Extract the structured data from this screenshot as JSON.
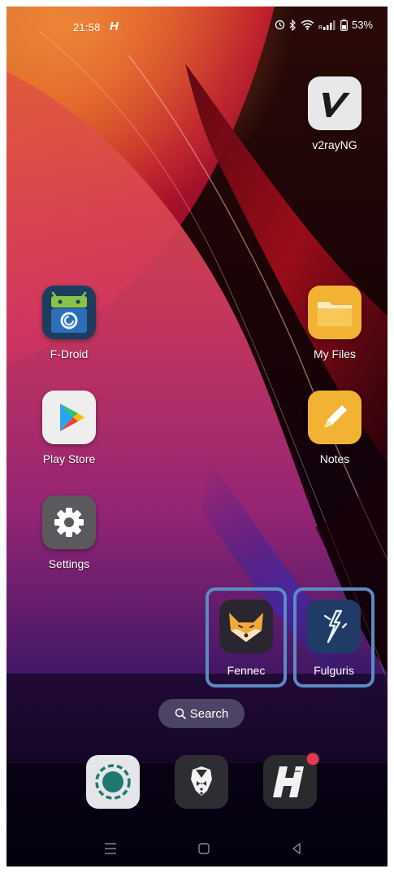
{
  "status_bar": {
    "time": "21:58",
    "notification_glyph": "H",
    "battery": "53%",
    "icons": [
      "alarm-icon",
      "bluetooth-icon",
      "wifi-icon",
      "signal-icon",
      "battery-icon"
    ]
  },
  "apps": {
    "v2rayng": "v2rayNG",
    "fdroid": "F-Droid",
    "myfiles": "My Files",
    "playstore": "Play Store",
    "notes": "Notes",
    "settings": "Settings",
    "fennec": "Fennec",
    "fulguris": "Fulguris"
  },
  "search": {
    "label": "Search"
  },
  "dock": {
    "items": [
      "signal-messenger-icon",
      "butler-icon",
      "h-app-icon"
    ],
    "badge_color": "#e8384f"
  },
  "navigation": {
    "buttons": [
      "recents-icon",
      "home-icon",
      "back-icon"
    ]
  },
  "colors": {
    "highlight_border": "#5b8bc4",
    "search_pill": "#585270"
  }
}
